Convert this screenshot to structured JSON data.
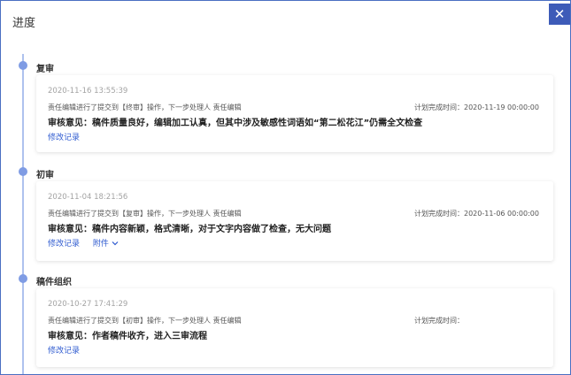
{
  "dialog": {
    "title": "进度",
    "close_glyph": "✕"
  },
  "stages": [
    {
      "name": "复审",
      "time": "2020-11-16 13:55:39",
      "action": "责任编辑进行了提交到【终审】操作，下一步处理人 责任编辑",
      "plan_label": "计划完成时间：",
      "plan_value": "2020-11-19 00:00:00",
      "opinion": "审核意见：稿件质量良好，编辑加工认真，但其中涉及敏感性词语如“第二松花江”仍需全文检查",
      "record_link": "修改记录"
    },
    {
      "name": "初审",
      "time": "2020-11-04 18:21:56",
      "action": "责任编辑进行了提交到【复审】操作，下一步处理人 责任编辑",
      "plan_label": "计划完成时间：",
      "plan_value": "2020-11-06 00:00:00",
      "opinion": "审核意见：稿件内容新颖，格式清晰，对于文字内容做了检查，无大问题",
      "record_link": "修改记录",
      "attachment_link": "附件"
    },
    {
      "name": "稿件组织",
      "time": "2020-10-27 17:41:29",
      "action": "责任编辑进行了提交到【初审】操作，下一步处理人 责任编辑",
      "plan_label": "计划完成时间：",
      "plan_value": "",
      "opinion": "审核意见：作者稿件收齐，进入三审流程",
      "record_link": "修改记录"
    }
  ]
}
